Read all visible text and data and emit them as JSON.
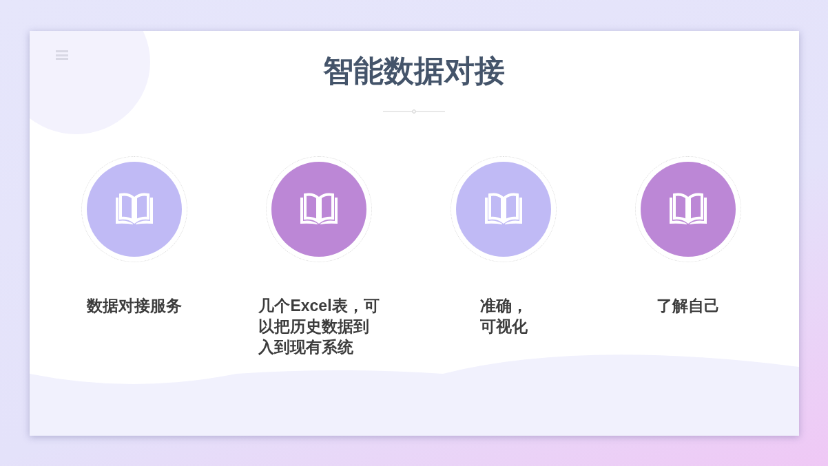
{
  "slide": {
    "title": "智能数据对接",
    "items": [
      {
        "color": "#c0baf5",
        "lines": [
          "数据对接服务"
        ]
      },
      {
        "color": "#bc87d6",
        "lines": [
          "几个Excel表，可",
          "以把历史数据到",
          "入到现有系统"
        ]
      },
      {
        "color": "#c0baf5",
        "lines": [
          "准确，",
          "可视化"
        ]
      },
      {
        "color": "#bc87d6",
        "lines": [
          "了解自己"
        ]
      }
    ]
  }
}
